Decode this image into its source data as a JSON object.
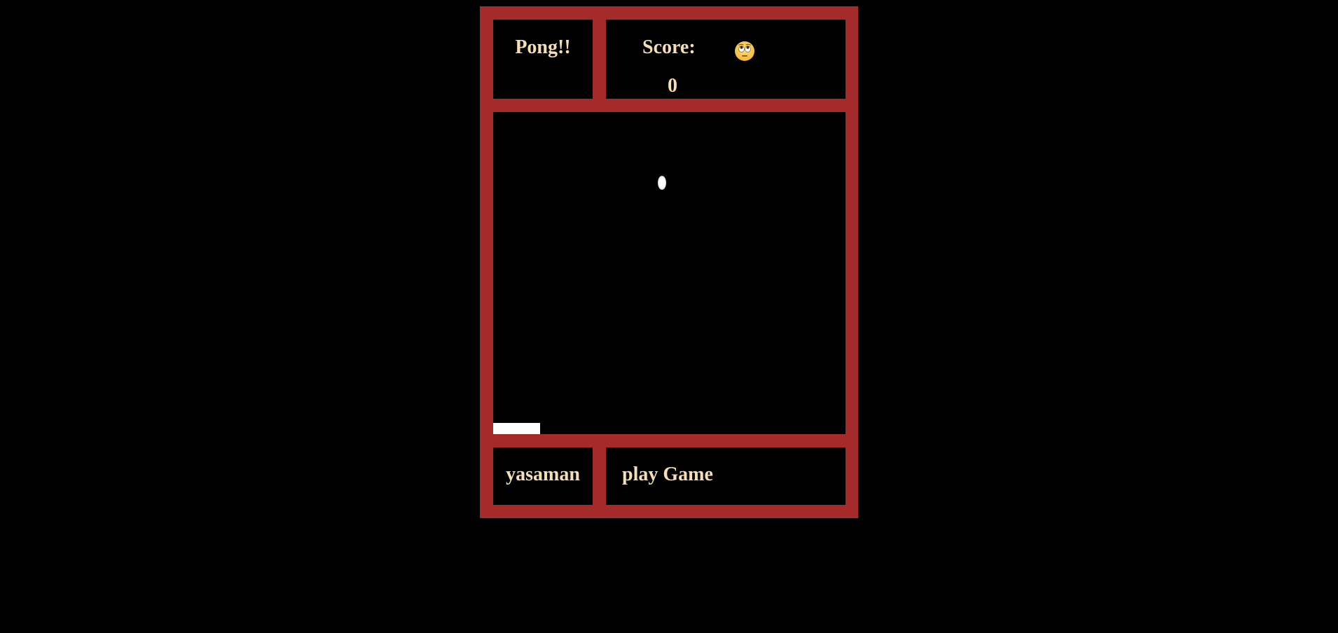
{
  "header": {
    "title": "Pong!!",
    "score_label": "Score:",
    "score_value": "0",
    "status_icon": "face-with-rolling-eyes-emoji"
  },
  "footer": {
    "player_name": "yasaman",
    "play_button_label": "play Game"
  },
  "game": {
    "ball_color": "#ffffff",
    "paddle_color": "#ffffff"
  },
  "colors": {
    "frame": "#a52a2a",
    "background": "#000000",
    "text": "#f5deb3"
  }
}
